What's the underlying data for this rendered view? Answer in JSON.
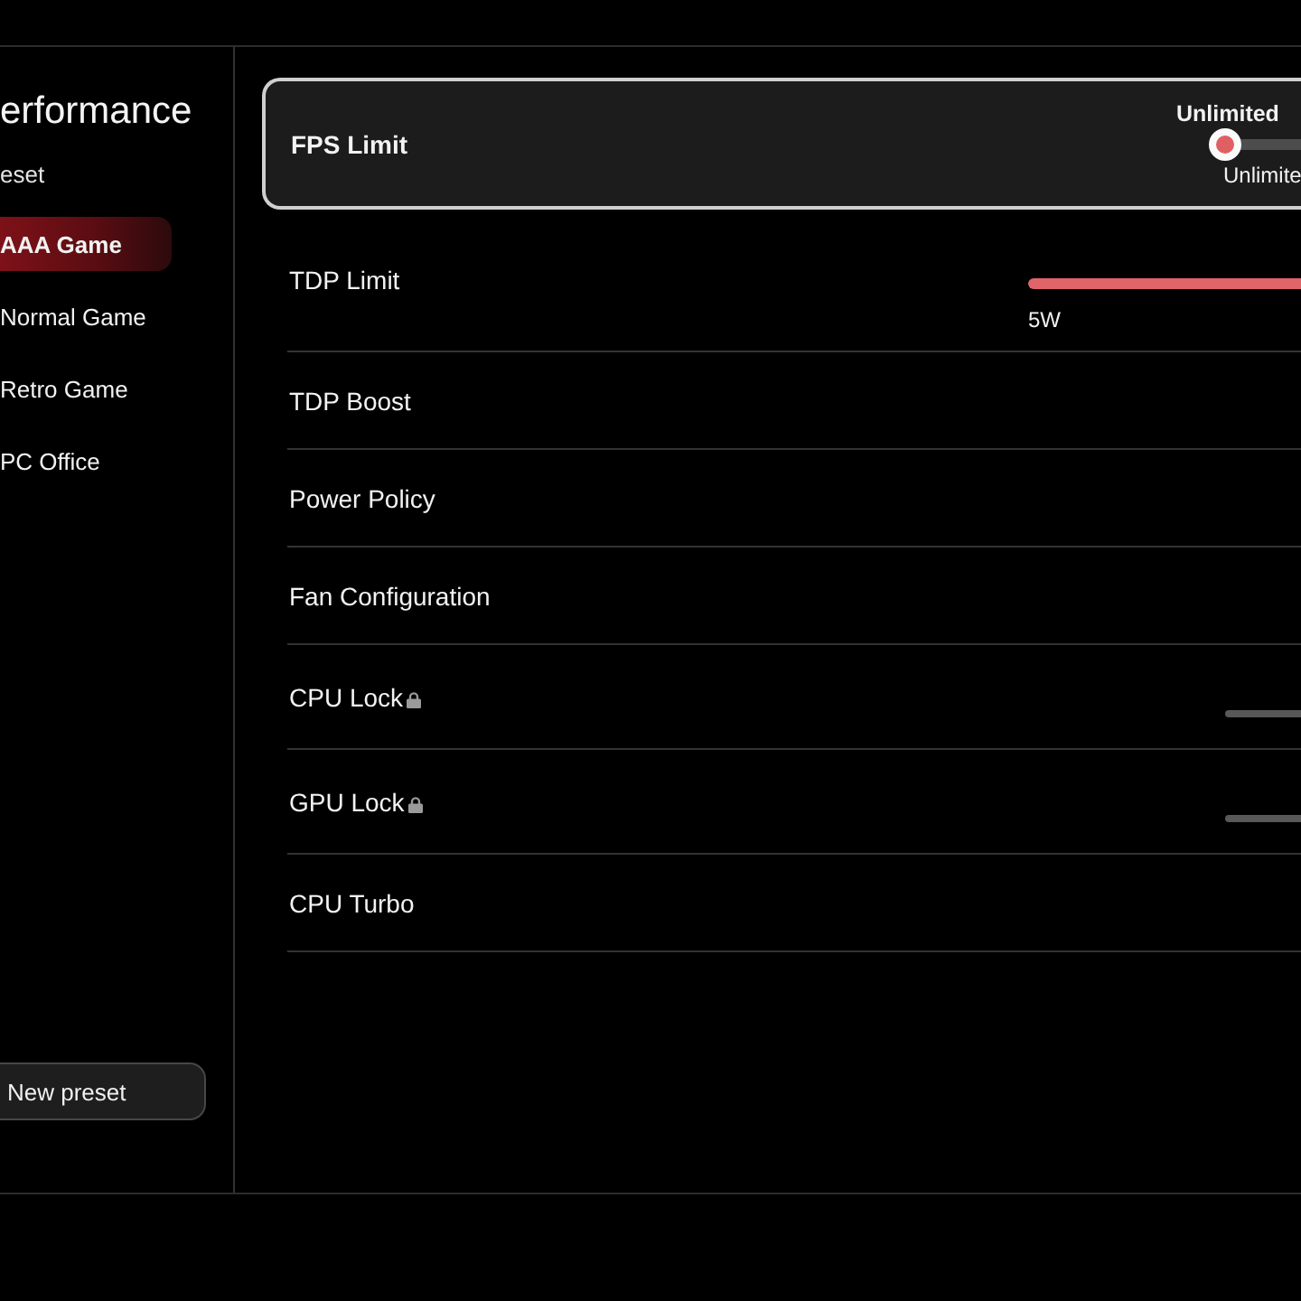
{
  "sidebar": {
    "title": "erformance",
    "section_label": "eset",
    "presets": [
      {
        "label": "AAA Game",
        "selected": true
      },
      {
        "label": "Normal Game",
        "selected": false
      },
      {
        "label": "Retro Game",
        "selected": false
      },
      {
        "label": "PC Office",
        "selected": false
      }
    ],
    "new_preset_button": "New preset"
  },
  "settings": [
    {
      "kind": "option-slider",
      "label": "FPS Limit",
      "focused": true,
      "locked": false,
      "value_label": "Unlimited",
      "level": 0,
      "end_label": "Unlimite"
    },
    {
      "kind": "range-slider",
      "label": "TDP Limit",
      "focused": false,
      "locked": false,
      "level": 1,
      "min_label": "5W"
    },
    {
      "kind": "plain",
      "label": "TDP Boost",
      "focused": false,
      "locked": false
    },
    {
      "kind": "plain",
      "label": "Power Policy",
      "focused": false,
      "locked": false
    },
    {
      "kind": "plain",
      "label": "Fan Configuration",
      "focused": false,
      "locked": false
    },
    {
      "kind": "track",
      "label": "CPU Lock",
      "focused": false,
      "locked": true
    },
    {
      "kind": "track",
      "label": "GPU Lock",
      "focused": false,
      "locked": true
    },
    {
      "kind": "plain",
      "label": "CPU Turbo",
      "focused": false,
      "locked": false
    }
  ]
}
